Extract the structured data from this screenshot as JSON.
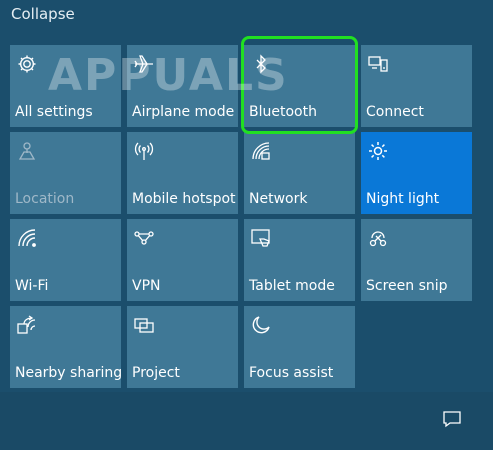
{
  "collapse_label": "Collapse",
  "watermark": "APPUALS",
  "tiles": [
    {
      "label": "All settings",
      "icon": "gear-icon",
      "state": "normal"
    },
    {
      "label": "Airplane mode",
      "icon": "airplane-icon",
      "state": "normal"
    },
    {
      "label": "Bluetooth",
      "icon": "bluetooth-icon",
      "state": "normal"
    },
    {
      "label": "Connect",
      "icon": "connect-icon",
      "state": "normal"
    },
    {
      "label": "Location",
      "icon": "location-icon",
      "state": "disabled"
    },
    {
      "label": "Mobile hotspot",
      "icon": "hotspot-icon",
      "state": "normal"
    },
    {
      "label": "Network",
      "icon": "network-icon",
      "state": "normal"
    },
    {
      "label": "Night light",
      "icon": "sun-icon",
      "state": "active"
    },
    {
      "label": "Wi-Fi",
      "icon": "wifi-icon",
      "state": "normal"
    },
    {
      "label": "VPN",
      "icon": "vpn-icon",
      "state": "normal"
    },
    {
      "label": "Tablet mode",
      "icon": "tablet-icon",
      "state": "normal"
    },
    {
      "label": "Screen snip",
      "icon": "scissors-icon",
      "state": "normal"
    },
    {
      "label": "Nearby sharing",
      "icon": "share-icon",
      "state": "normal"
    },
    {
      "label": "Project",
      "icon": "project-icon",
      "state": "normal"
    },
    {
      "label": "Focus assist",
      "icon": "moon-icon",
      "state": "normal"
    }
  ],
  "highlighted_tile": "Bluetooth",
  "colors": {
    "background": "#1b4e6c",
    "tile": "#3f7896",
    "tile_active": "#0a78d7",
    "highlight": "#21e021"
  },
  "bottom_icon": "action-center-icon"
}
